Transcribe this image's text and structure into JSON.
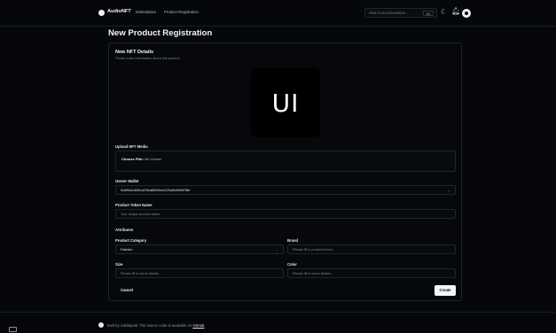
{
  "nav": {
    "brand": "AudioNFT",
    "links": [
      "Marketplace",
      "Product Registration"
    ],
    "search_placeholder": "Search documentation...",
    "search_shortcut": "⌘K",
    "icons": [
      "logo-icon",
      "moon-icon",
      "bell-icon",
      "avatar-icon"
    ]
  },
  "page": {
    "title": "New Product Registration"
  },
  "card": {
    "title": "New NFT Details",
    "subtitle": "Please enter information about this product.",
    "preview_text": "UI",
    "upload": {
      "label": "Upload NFT Media",
      "button": "Choose File",
      "status": "No file chosen"
    },
    "owner": {
      "label": "Owner Wallet",
      "value": "0xd95a1d451cd78ca8633ee1120a5e4f6bf78fe"
    },
    "token_name": {
      "label": "Product Token Name",
      "placeholder": "Your unique product name"
    },
    "attributes": {
      "heading": "Attributes",
      "category_label": "Product Category",
      "category_value": "Fashion",
      "brand_label": "Brand",
      "brand_placeholder": "Please fill in product brand...",
      "size_label": "Size",
      "size_placeholder": "Please fill in some details...",
      "color_label": "Color",
      "color_placeholder": "Please fill in some details..."
    },
    "buttons": {
      "cancel": "Cancel",
      "create": "Create"
    }
  },
  "footer": {
    "text": "Built by nabilapudi. The source code is available on",
    "link": "GitHub",
    "suffix": "."
  },
  "colors": {
    "background": "#05070b",
    "card": "#06080c",
    "border": "#1f242c",
    "primary_button": "#f4f5f7"
  }
}
